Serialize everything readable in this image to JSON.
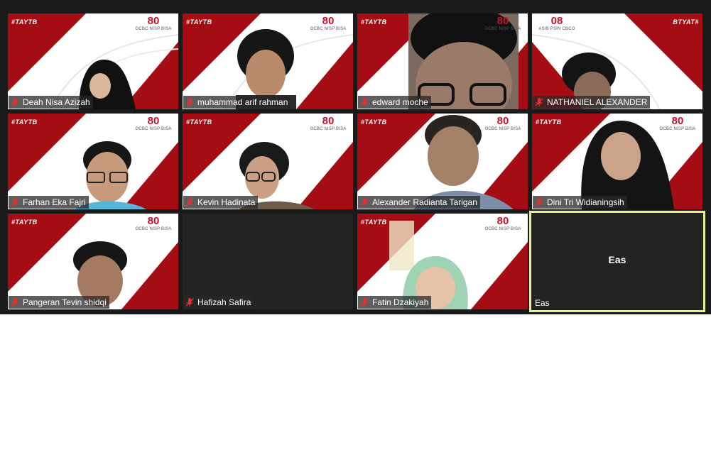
{
  "meeting": {
    "brand_hashtag": "#TAYTB",
    "brand_logo_number": "80",
    "brand_logo_text": "OCBC NISP BISA",
    "participants": [
      {
        "name": "Deah Nisa Azizah",
        "muted": true
      },
      {
        "name": "muhammad arif rahman",
        "muted": true
      },
      {
        "name": "edward moche",
        "muted": true
      },
      {
        "name": "NATHANIEL ALEXANDER",
        "muted": true
      },
      {
        "name": "Farhan Eka Fajri",
        "muted": true
      },
      {
        "name": "Kevin Hadinata",
        "muted": true
      },
      {
        "name": "Alexander Radianta Tarigan",
        "muted": true
      },
      {
        "name": "Dini Tri Widianingsih",
        "muted": true
      },
      {
        "name": "Pangeran Tevin shidqi",
        "muted": true
      },
      {
        "name": "Hafizah Safira",
        "muted": true
      },
      {
        "name": "Fatin Dzakiyah",
        "muted": true
      },
      {
        "name": "Eas",
        "muted": false,
        "video_off_label": "Eas"
      }
    ]
  },
  "colors": {
    "brand_red": "#a50d14",
    "active_speaker": "#e8f08c",
    "grid_background": "#1a1a1a"
  },
  "icons": {
    "muted_mic": "microphone-muted-icon"
  }
}
